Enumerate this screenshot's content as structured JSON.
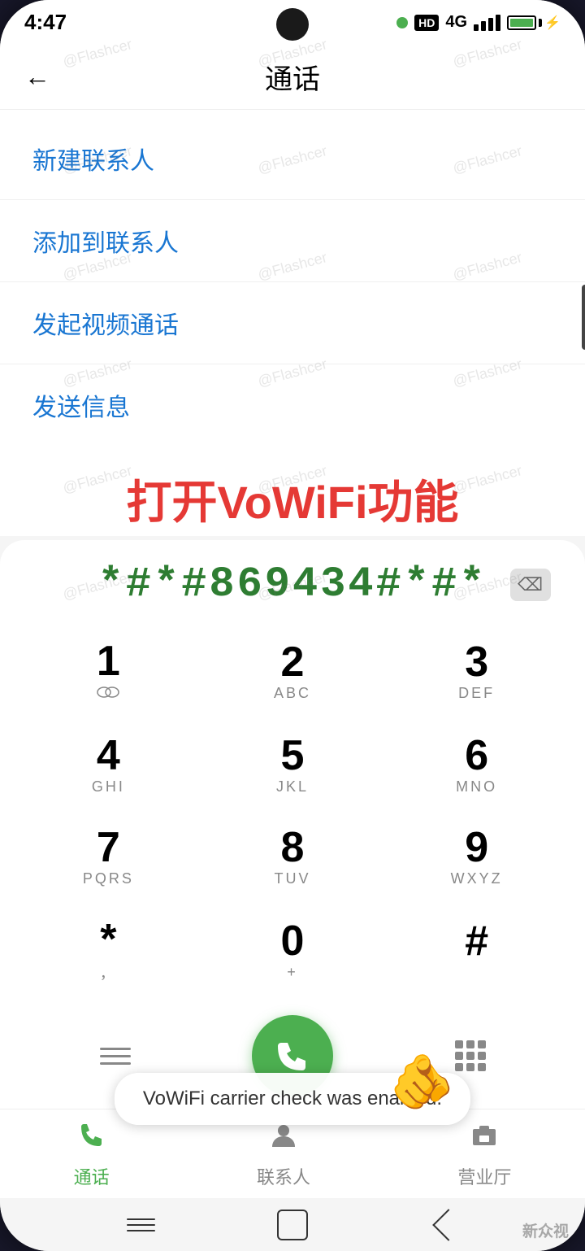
{
  "phone": {
    "status_bar": {
      "time": "4:47",
      "hd_label": "HD",
      "signal_label": "4G"
    },
    "top_nav": {
      "back_icon": "←",
      "title": "通话"
    },
    "menu_items": [
      {
        "label": "新建联系人"
      },
      {
        "label": "添加到联系人"
      },
      {
        "label": "发起视频通话"
      },
      {
        "label": "发送信息"
      }
    ],
    "banner": {
      "text": "打开VoWiFi功能"
    },
    "dialer": {
      "input": "*#*#869434#*#*",
      "backspace_icon": "⌫",
      "keys": [
        {
          "main": "1",
          "sub": ""
        },
        {
          "main": "2",
          "sub": "ABC"
        },
        {
          "main": "3",
          "sub": "DEF"
        },
        {
          "main": "4",
          "sub": "GHI"
        },
        {
          "main": "5",
          "sub": "JKL"
        },
        {
          "main": "6",
          "sub": "MNO"
        },
        {
          "main": "7",
          "sub": "PQRS"
        },
        {
          "main": "8",
          "sub": "TUV"
        },
        {
          "main": "9",
          "sub": "WXYZ"
        },
        {
          "main": "*",
          "sub": "，"
        },
        {
          "main": "0",
          "sub": "+"
        },
        {
          "main": "#",
          "sub": ""
        }
      ]
    },
    "toast": {
      "message": "VoWiFi carrier check was enabled."
    },
    "bottom_nav": {
      "items": [
        {
          "label": "通话",
          "active": true
        },
        {
          "label": "联系人",
          "active": false
        },
        {
          "label": "营业厅",
          "active": false
        }
      ]
    },
    "system_nav": {
      "menu_btn": "≡",
      "home_btn": "○",
      "back_btn": "<"
    },
    "watermarks": [
      "@Flashcer",
      "@Flashcer",
      "@Flashcer"
    ]
  }
}
